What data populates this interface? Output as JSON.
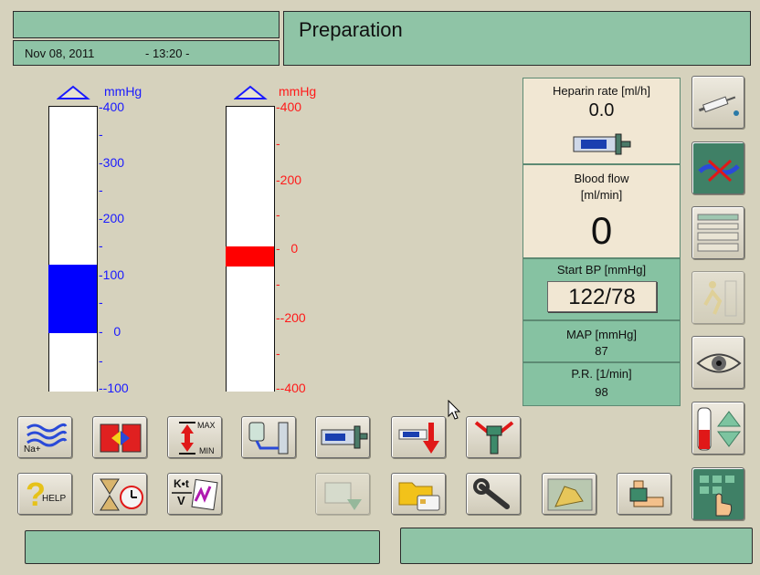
{
  "header": {
    "title": "Preparation",
    "date": "Nov 08, 2011",
    "time": "- 13:20 -"
  },
  "gauge_left": {
    "unit": "mmHg",
    "color": "#1a1aff",
    "ticks": [
      "400",
      "300",
      "200",
      "100",
      "0",
      "-100"
    ],
    "bar_from": 125,
    "bar_to": 0
  },
  "gauge_right": {
    "unit": "mmHg",
    "color": "#ff1a1a",
    "ticks": [
      "400",
      "200",
      "0",
      "-200",
      "-400"
    ],
    "bar_from": 0,
    "bar_to": -40
  },
  "panel": {
    "heparin_label": "Heparin rate  [ml/h]",
    "heparin_value": "0.0",
    "blood_flow_label_1": "Blood flow",
    "blood_flow_label_2": "[ml/min]",
    "blood_flow_value": "0",
    "start_bp_label": "Start BP [mmHg]",
    "start_bp_value": "122/78",
    "map_label": "MAP  [mmHg]",
    "map_value": "87",
    "pr_label": "P.R. [1/min]",
    "pr_value": "98"
  },
  "buttons": {
    "na_label": "Na+",
    "max_label": "MAX",
    "min_label": "MIN",
    "help_label": "HELP",
    "kt_label": "K•t",
    "v_label": "V"
  },
  "status_left": "",
  "status_right": ""
}
